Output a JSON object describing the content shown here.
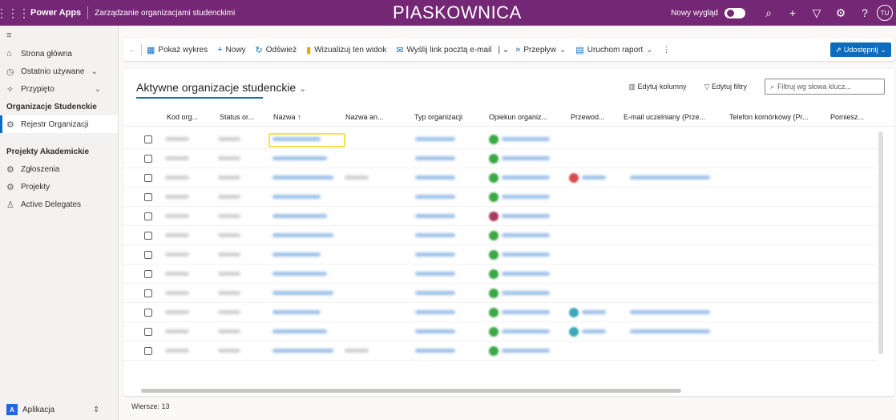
{
  "topbar": {
    "brand": "Power Apps",
    "app_name": "Zarządzanie organizacjami studenckimi",
    "environment": "PIASKOWNICA",
    "new_look": "Nowy wygląd",
    "avatar": "TU"
  },
  "sidebar": {
    "home": "Strona główna",
    "recent": "Ostatnio używane",
    "pinned": "Przypięto",
    "section1": "Organizacje Studenckie",
    "item_registry": "Rejestr Organizacji",
    "section2": "Projekty Akademickie",
    "item_submissions": "Zgłoszenia",
    "item_projects": "Projekty",
    "item_delegates": "Active Delegates",
    "app_switch": "Aplikacja",
    "app_tile": "A"
  },
  "commands": {
    "show_chart": "Pokaż wykres",
    "new": "Nowy",
    "refresh": "Odśwież",
    "visualize": "Wizualizuj ten widok",
    "email_link": "Wyślij link pocztą e-mail",
    "flow": "Przepływ",
    "run_report": "Uruchom raport",
    "share": "Udostępnij"
  },
  "view": {
    "title": "Aktywne organizacje studenckie",
    "edit_columns": "Edytuj kolumny",
    "edit_filters": "Edytuj filtry",
    "filter_placeholder": "Filtruj wg słowa klucz..."
  },
  "columns": [
    "Kod org...",
    "Status or...",
    "Nazwa ↑",
    "Nazwa an...",
    "Typ organizacji",
    "Opiekun organiz...",
    "Przewod...",
    "E-mail uczelniany (Prze...",
    "Telefon komórkowy (Pr...",
    "Pomiesz..."
  ],
  "footer": {
    "rows": "Wiersze: 13"
  },
  "colors": {
    "topbar": "#742774",
    "accent": "#0f6cbd",
    "focus": "#f7e24a"
  }
}
